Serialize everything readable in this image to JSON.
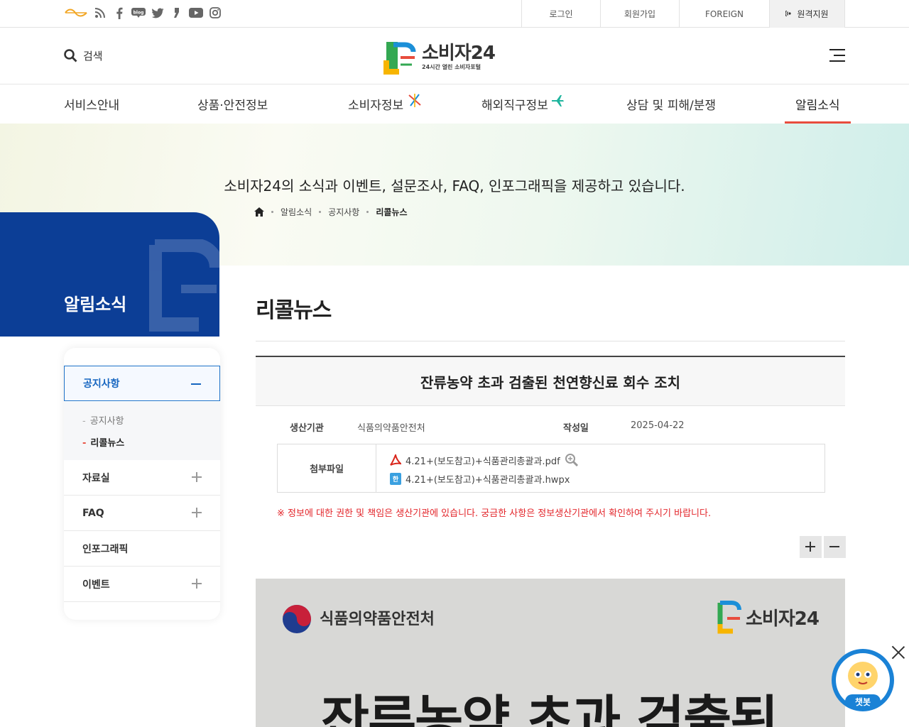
{
  "util": {
    "links": {
      "login": "로그인",
      "join": "회원가입",
      "foreign": "FOREIGN",
      "remote": "원격지원"
    },
    "sns_icons": [
      "eg-icon",
      "rss-icon",
      "facebook-icon",
      "blog-icon",
      "twitter-icon",
      "story-icon",
      "youtube-icon",
      "instagram-icon"
    ]
  },
  "header": {
    "search_label": "검색",
    "logo_title": "소비자24",
    "logo_sub": "24시간 열린 소비자포털"
  },
  "gnb": [
    "서비스안내",
    "상품·안전정보",
    "소비자정보",
    "해외직구정보",
    "상담 및 피해/분쟁",
    "알림소식"
  ],
  "hero": {
    "message": "소비자24의 소식과 이벤트, 설문조사, FAQ, 인포그래픽을 제공하고 있습니다.",
    "breadcrumb": [
      "알림소식",
      "공지사항",
      "리콜뉴스"
    ]
  },
  "lnb": {
    "title": "알림소식",
    "menu": [
      "공지사항",
      "자료실",
      "FAQ",
      "인포그래픽",
      "이벤트"
    ],
    "sub": [
      "공지사항",
      "리콜뉴스"
    ]
  },
  "content": {
    "page_title": "리콜뉴스",
    "article_title": "잔류농약 초과 검출된 천연향신료 회수 조치",
    "producer_label": "생산기관",
    "producer": "식품의약품안전처",
    "date_label": "작성일",
    "date": "2025-04-22",
    "attach_label": "첨부파일",
    "files": [
      "4.21+(보도참고)+식품관리총괄과.pdf",
      "4.21+(보도참고)+식품관리총괄과.hwpx"
    ],
    "notice": "※ 정보에 대한 권한 및 책임은 생산기관에 있습니다. 궁금한 사항은 정보생산기관에서 확인하여 주시기 바랍니다."
  },
  "image": {
    "org": "식품의약품안전처",
    "brand": "소비자24",
    "headline": "잔류농약 초과 검출된"
  },
  "chatbot": {
    "label": "챗봇"
  },
  "colors": {
    "primary": "#0c3e96",
    "accent": "#e84c3d",
    "notice": "#e3262b",
    "link_blue": "#1565c0"
  }
}
